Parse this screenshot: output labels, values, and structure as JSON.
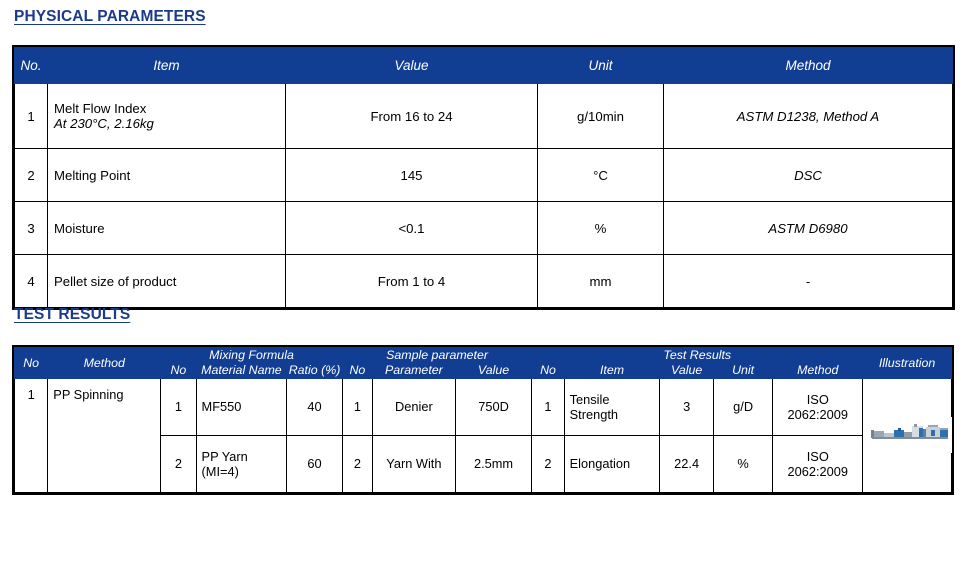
{
  "theme": {
    "header_blue": "#113D92",
    "heading_blue": "#1B3A8C",
    "border": "#000000",
    "background": "#FFFFFF"
  },
  "sections": {
    "physical": {
      "heading": "PHYSICAL PARAMETERS"
    },
    "test": {
      "heading": "TEST RESULTS"
    }
  },
  "physical_table": {
    "headers": {
      "no": "No.",
      "item": "Item",
      "value": "Value",
      "unit": "Unit",
      "method": "Method"
    },
    "rows": [
      {
        "no": "1",
        "item": "Melt Flow Index",
        "item_note": "At 230°C, 2.16kg",
        "value": "From 16 to 24",
        "unit": "g/10min",
        "method": "ASTM D1238, Method A"
      },
      {
        "no": "2",
        "item": "Melting Point",
        "item_note": "",
        "value": "145",
        "unit": "°C",
        "method": "DSC"
      },
      {
        "no": "3",
        "item": "Moisture",
        "item_note": "",
        "value": "<0.1",
        "unit": "%",
        "method": "ASTM D6980"
      },
      {
        "no": "4",
        "item": "Pellet size of product",
        "item_note": "",
        "value": "From 1 to 4",
        "unit": "mm",
        "method": "-"
      }
    ]
  },
  "test_table": {
    "headers": {
      "no": "No",
      "method": "Method",
      "group_mixing": "Mixing Formula",
      "group_sample": "Sample parameter",
      "group_results": "Test Results",
      "illustration": "Illustration",
      "mix_no": "No",
      "mix_material": "Material Name",
      "mix_ratio": "Ratio (%)",
      "sample_no": "No",
      "sample_parameter": "Parameter",
      "sample_value": "Value",
      "result_no": "No",
      "result_item": "Item",
      "result_value": "Value",
      "result_unit": "Unit",
      "result_method": "Method"
    },
    "rows": [
      {
        "no": "1",
        "method": "PP Spinning",
        "sub_rows": [
          {
            "mix_no": "1",
            "mix_material": "MF550",
            "mix_ratio": "40",
            "sample_no": "1",
            "sample_parameter": "Denier",
            "sample_value": "750D",
            "result_no": "1",
            "result_item": "Tensile Strength",
            "result_value": "3",
            "result_unit": "g/D",
            "result_method": "ISO 2062:2009"
          },
          {
            "mix_no": "2",
            "mix_material": "PP Yarn (MI=4)",
            "mix_ratio": "60",
            "sample_no": "2",
            "sample_parameter": "Yarn With",
            "sample_value": "2.5mm",
            "result_no": "2",
            "result_item": "Elongation",
            "result_value": "22.4",
            "result_unit": "%",
            "result_method": "ISO 2062:2009"
          }
        ],
        "illustration_alt": "extrusion-line-machine-photo"
      }
    ]
  }
}
